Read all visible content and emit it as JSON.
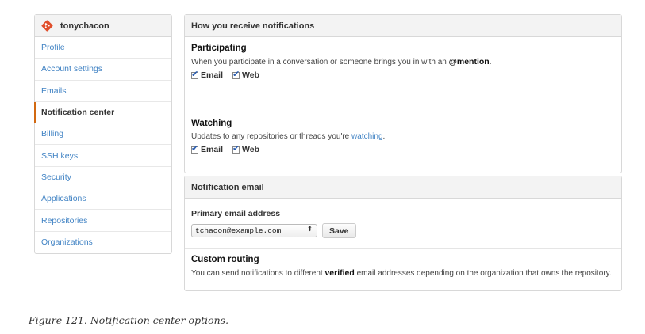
{
  "sidebar": {
    "username": "tonychacon",
    "items": [
      {
        "label": "Profile",
        "active": false
      },
      {
        "label": "Account settings",
        "active": false
      },
      {
        "label": "Emails",
        "active": false
      },
      {
        "label": "Notification center",
        "active": true
      },
      {
        "label": "Billing",
        "active": false
      },
      {
        "label": "SSH keys",
        "active": false
      },
      {
        "label": "Security",
        "active": false
      },
      {
        "label": "Applications",
        "active": false
      },
      {
        "label": "Repositories",
        "active": false
      },
      {
        "label": "Organizations",
        "active": false
      }
    ]
  },
  "notifications": {
    "header": "How you receive notifications",
    "participating": {
      "title": "Participating",
      "desc_prefix": "When you participate in a conversation or someone brings you in with an ",
      "desc_mention": "@mention",
      "desc_suffix": ".",
      "email_label": "Email",
      "web_label": "Web"
    },
    "watching": {
      "title": "Watching",
      "desc_prefix": "Updates to any repositories or threads you're ",
      "desc_link": "watching",
      "desc_suffix": ".",
      "email_label": "Email",
      "web_label": "Web"
    }
  },
  "notification_email": {
    "header": "Notification email",
    "primary_label": "Primary email address",
    "selected_email": "tchacon@example.com",
    "save_label": "Save",
    "custom_routing": {
      "title": "Custom routing",
      "desc_prefix": "You can send notifications to different ",
      "desc_bold": "verified",
      "desc_suffix": " email addresses depending on the organization that owns the repository."
    }
  },
  "caption": "Figure 121. Notification center options.",
  "colors": {
    "link": "#4183c4",
    "active_marker": "#d26911",
    "logo": "#e04e2b"
  }
}
